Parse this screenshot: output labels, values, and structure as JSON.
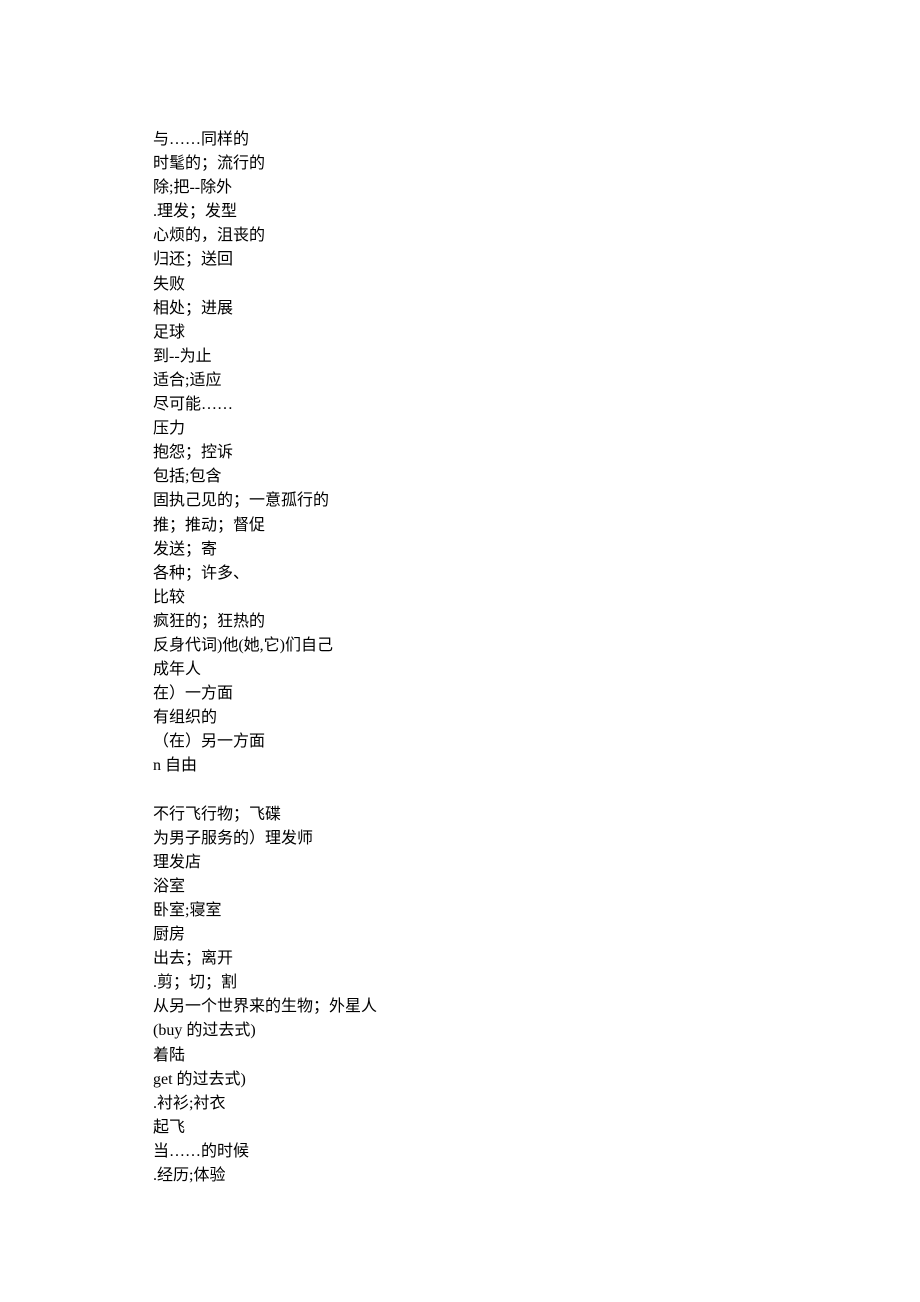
{
  "lines": [
    "与……同样的",
    "时髦的；流行的",
    "除;把--除外",
    ".理发；发型",
    "心烦的，沮丧的",
    "归还；送回",
    "失败",
    "相处；进展",
    "足球",
    "到--为止",
    "适合;适应",
    "尽可能……",
    "压力",
    "抱怨；控诉",
    "包括;包含",
    "固执己见的；一意孤行的",
    "推；推动；督促",
    "发送；寄",
    "各种；许多、",
    "比较",
    "疯狂的；狂热的",
    "反身代词)他(她,它)们自己",
    "成年人",
    "在）一方面",
    "有组织的",
    "（在）另一方面",
    "n 自由",
    "",
    "不行飞行物；飞碟",
    "为男子服务的）理发师",
    "理发店",
    "浴室",
    "卧室;寝室",
    "厨房",
    "出去；离开",
    ".剪；切；割",
    "从另一个世界来的生物；外星人",
    "(buy 的过去式)",
    "着陆",
    "get 的过去式)",
    ".衬衫;衬衣",
    "起飞",
    "当……的时候",
    ".经历;体验"
  ]
}
